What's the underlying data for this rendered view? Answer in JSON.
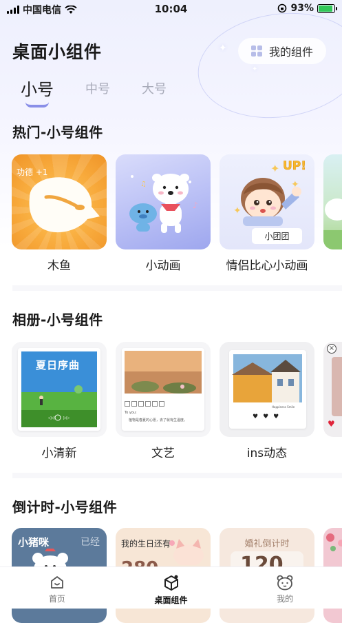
{
  "status_bar": {
    "carrier": "中国电信",
    "time": "10:04",
    "battery": "93%"
  },
  "header": {
    "title": "桌面小组件",
    "my_widgets_label": "我的组件"
  },
  "tabs": [
    {
      "label": "小号"
    },
    {
      "label": "中号"
    },
    {
      "label": "大号"
    }
  ],
  "sections": [
    {
      "title": "热门-小号组件",
      "items": [
        {
          "caption": "木鱼",
          "overlay": "功德 +1"
        },
        {
          "caption": "小动画"
        },
        {
          "caption": "情侣比心小动画",
          "overlay": "小团团",
          "overlay2": "UP!"
        },
        {
          "caption": ""
        }
      ]
    },
    {
      "title": "相册-小号组件",
      "items": [
        {
          "caption": "小清新",
          "overlay": "夏日序曲"
        },
        {
          "caption": "文艺",
          "overlay": "To you:",
          "overlay2": "植物是春夏的心愿，去了就有生温度。"
        },
        {
          "caption": "ins动态",
          "overlay": "Happiness Smile"
        }
      ]
    },
    {
      "title": "倒计时-小号组件",
      "items": [
        {
          "overlay": "小猪咪",
          "overlay2": "已经"
        },
        {
          "overlay": "我的生日还有",
          "overlay2": "280"
        },
        {
          "overlay": "婚礼倒计时",
          "overlay2": "120"
        },
        {
          "overlay": ""
        }
      ]
    }
  ],
  "bottom_nav": [
    {
      "label": "首页",
      "icon": "home-icon"
    },
    {
      "label": "桌面组件",
      "icon": "widget-cube-icon"
    },
    {
      "label": "我的",
      "icon": "profile-bear-icon"
    }
  ],
  "colors": {
    "accent": "#8a8fe8",
    "battery": "#32c759",
    "muyu_orange": "#f7a83a"
  }
}
